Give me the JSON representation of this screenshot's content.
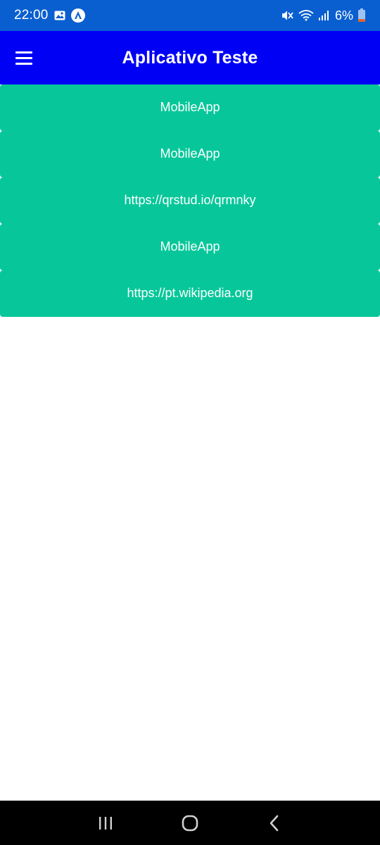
{
  "status_bar": {
    "time": "22:00",
    "battery": "6%",
    "icons": [
      "gallery-icon",
      "app-notification-icon",
      "mute-icon",
      "wifi-icon",
      "signal-icon",
      "battery-icon"
    ]
  },
  "app_bar": {
    "title": "Aplicativo Teste",
    "menu_icon": "hamburger-menu-icon"
  },
  "list": {
    "items": [
      {
        "label": "MobileApp"
      },
      {
        "label": "MobileApp"
      },
      {
        "label": "https://qrstud.io/qrmnky"
      },
      {
        "label": "MobileApp"
      },
      {
        "label": "https://pt.wikipedia.org"
      }
    ]
  },
  "nav_bar": {
    "buttons": [
      "recents-icon",
      "home-icon",
      "back-icon"
    ]
  },
  "colors": {
    "status_bar": "#0a5fd0",
    "app_bar": "#0000f5",
    "list_item": "#07c79a",
    "nav_bar": "#000000",
    "battery_low": "#e0662c"
  }
}
